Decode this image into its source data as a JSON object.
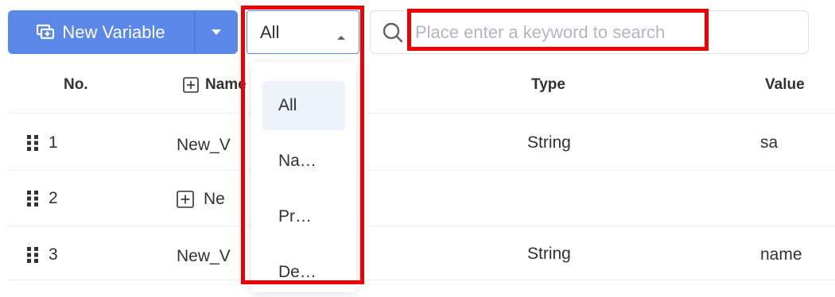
{
  "toolbar": {
    "new_variable_label": "New Variable",
    "filter_selected": "All",
    "search_placeholder": "Place enter a keyword to search"
  },
  "table": {
    "headers": {
      "no": "No.",
      "name": "Name",
      "type": "Type",
      "value": "Value"
    },
    "rows": [
      {
        "no": "1",
        "name": "New_V",
        "type": "String",
        "value": "sa"
      },
      {
        "no": "2",
        "name": "Ne",
        "type": "",
        "value": ""
      },
      {
        "no": "3",
        "name": "New_V",
        "type": "String",
        "value": "name"
      }
    ]
  },
  "dropdown": {
    "options": [
      "All",
      "Na…",
      "Pr…",
      "De…"
    ],
    "selected": "All"
  },
  "colors": {
    "primary": "#5b87e8",
    "highlight": "#ee0000"
  }
}
